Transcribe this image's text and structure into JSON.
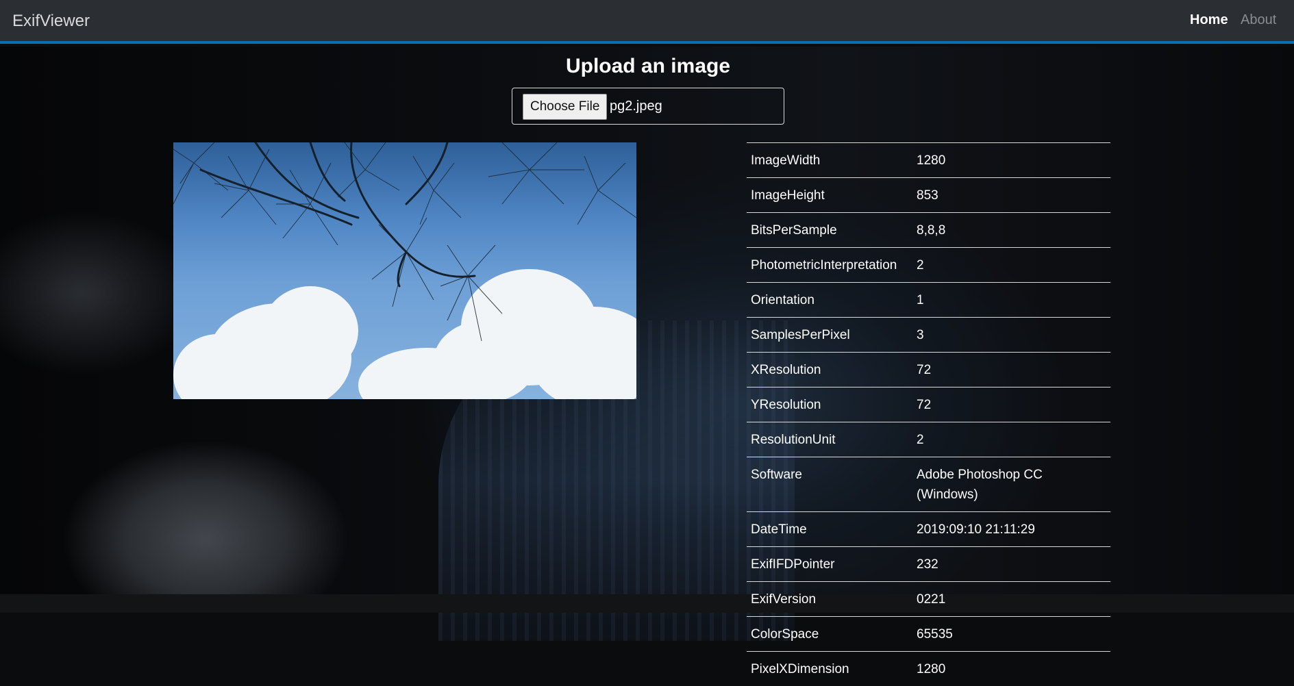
{
  "app": {
    "brand": "ExifViewer"
  },
  "nav": {
    "home": "Home",
    "about": "About"
  },
  "upload": {
    "title": "Upload an image",
    "button_label": "Choose File",
    "file_name": "pg2.jpeg"
  },
  "exif": [
    {
      "key": "ImageWidth",
      "value": "1280"
    },
    {
      "key": "ImageHeight",
      "value": "853"
    },
    {
      "key": "BitsPerSample",
      "value": "8,8,8"
    },
    {
      "key": "PhotometricInterpretation",
      "value": "2"
    },
    {
      "key": "Orientation",
      "value": "1"
    },
    {
      "key": "SamplesPerPixel",
      "value": "3"
    },
    {
      "key": "XResolution",
      "value": "72"
    },
    {
      "key": "YResolution",
      "value": "72"
    },
    {
      "key": "ResolutionUnit",
      "value": "2"
    },
    {
      "key": "Software",
      "value": "Adobe Photoshop CC (Windows)"
    },
    {
      "key": "DateTime",
      "value": "2019:09:10 21:11:29"
    },
    {
      "key": "ExifIFDPointer",
      "value": "232"
    },
    {
      "key": "ExifVersion",
      "value": "0221"
    },
    {
      "key": "ColorSpace",
      "value": "65535"
    },
    {
      "key": "PixelXDimension",
      "value": "1280"
    }
  ],
  "colors": {
    "navbar": "#2b2f34",
    "accent": "#0a6fae"
  }
}
